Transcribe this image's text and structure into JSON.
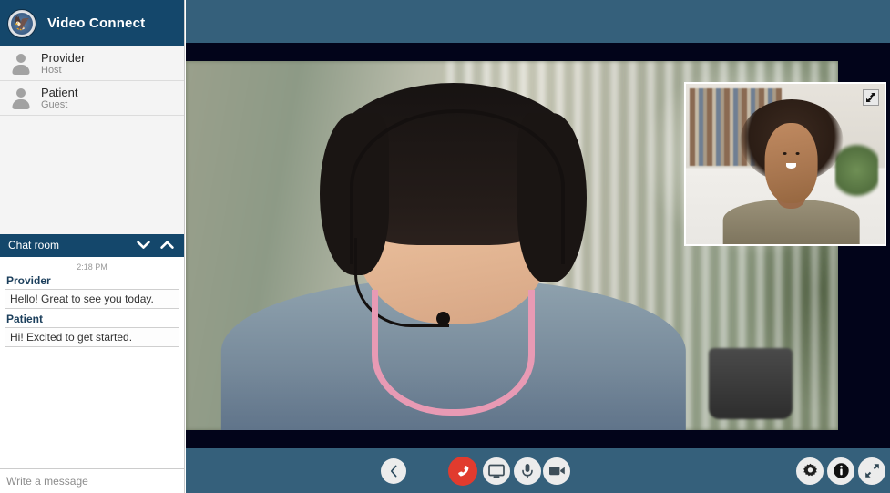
{
  "app": {
    "title": "Video Connect",
    "logo_icon": "va-seal-icon"
  },
  "sidebar": {
    "participants": [
      {
        "name": "Provider",
        "role": "Host"
      },
      {
        "name": "Patient",
        "role": "Guest"
      }
    ],
    "chat": {
      "title": "Chat room",
      "collapse_icon": "chevron-down-icon",
      "expand_icon": "chevron-up-icon",
      "timestamp": "2:18 PM",
      "messages": [
        {
          "author": "Provider",
          "text": "Hello! Great to see you today."
        },
        {
          "author": "Patient",
          "text": "Hi! Excited to get started."
        }
      ],
      "input_placeholder": "Write a message",
      "input_value": ""
    }
  },
  "stage": {
    "main_video_label": "Provider video",
    "pip_label": "Patient self-view",
    "pip_expand_icon": "expand-pip-icon"
  },
  "controls": {
    "collapse_sidebar": {
      "label": "Collapse panel",
      "icon": "chevron-left-icon"
    },
    "end_call": {
      "label": "End call",
      "icon": "hangup-icon",
      "color": "#e13b2e"
    },
    "share_screen": {
      "label": "Share screen",
      "icon": "monitor-icon"
    },
    "microphone": {
      "label": "Microphone",
      "icon": "microphone-icon"
    },
    "camera": {
      "label": "Camera",
      "icon": "video-camera-icon"
    },
    "settings": {
      "label": "Settings",
      "icon": "gear-icon"
    },
    "info": {
      "label": "Information",
      "icon": "info-circle-icon"
    },
    "fullscreen": {
      "label": "Full screen",
      "icon": "fullscreen-arrows-icon"
    }
  },
  "colors": {
    "brand_navy": "#14476b",
    "stage_blue": "#35607b",
    "sidebar_bg": "#f4f4f4",
    "danger_red": "#e13b2e"
  }
}
